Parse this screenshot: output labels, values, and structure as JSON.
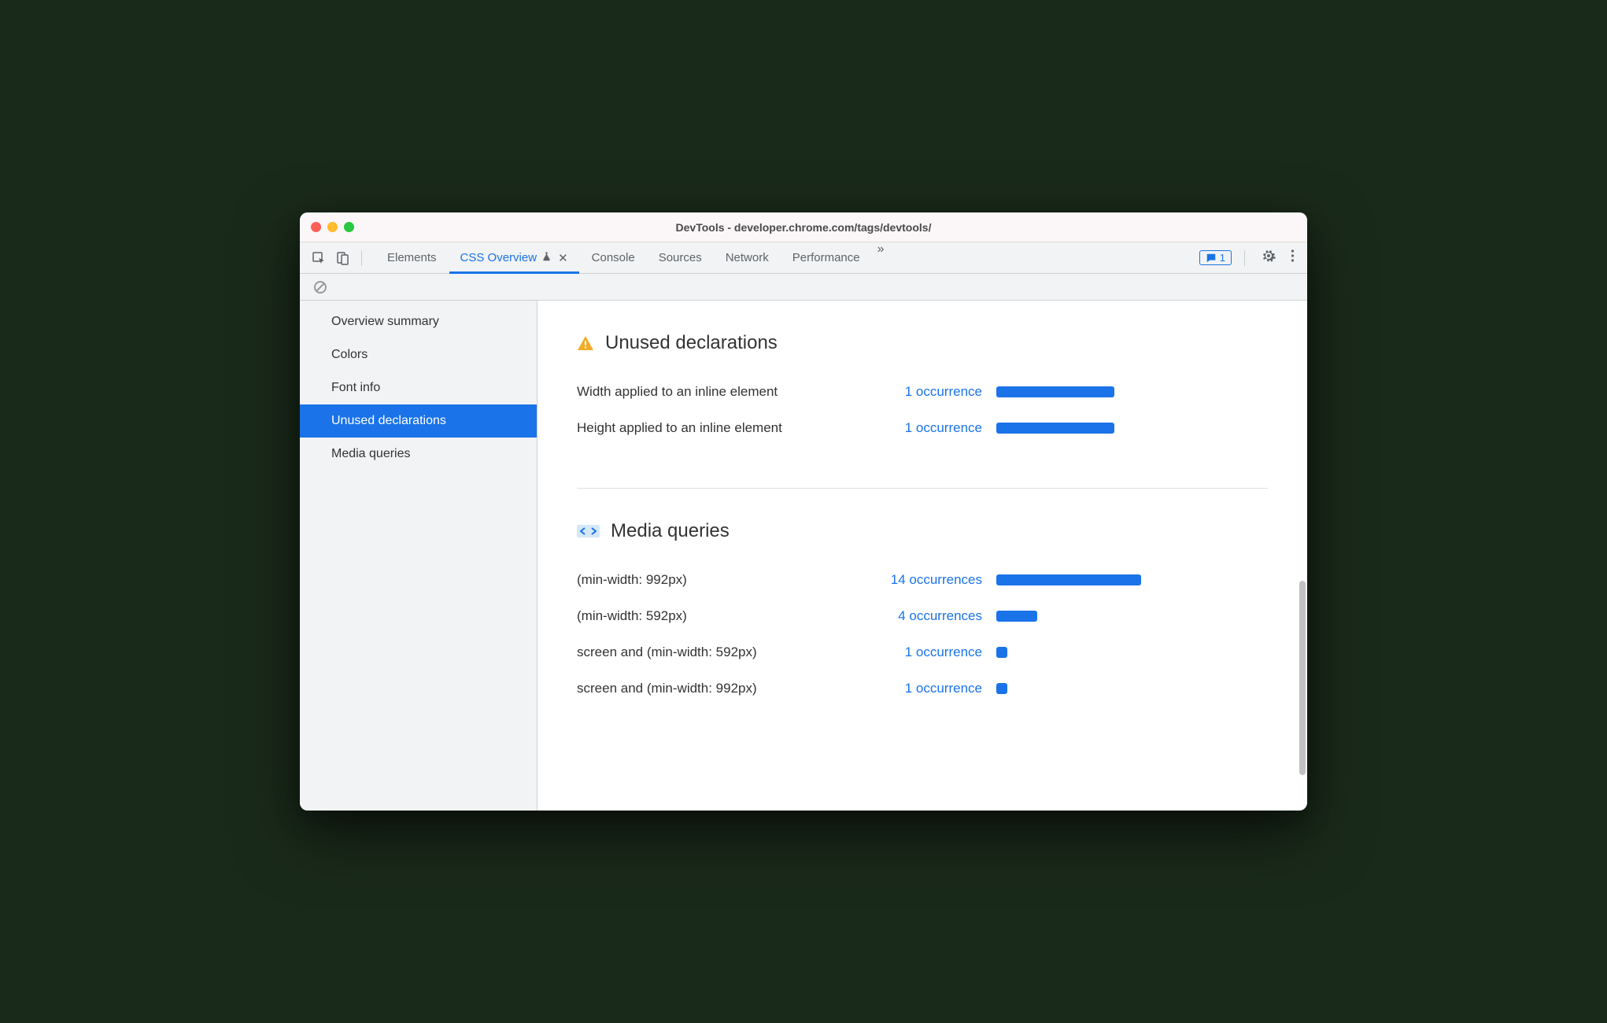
{
  "window": {
    "title": "DevTools - developer.chrome.com/tags/devtools/"
  },
  "toolbar": {
    "tabs": [
      {
        "label": "Elements",
        "active": false
      },
      {
        "label": "CSS Overview",
        "active": true,
        "experimental": true,
        "closable": true
      },
      {
        "label": "Console",
        "active": false
      },
      {
        "label": "Sources",
        "active": false
      },
      {
        "label": "Network",
        "active": false
      },
      {
        "label": "Performance",
        "active": false
      }
    ],
    "messages_count": "1"
  },
  "sidebar": {
    "items": [
      {
        "label": "Overview summary",
        "active": false
      },
      {
        "label": "Colors",
        "active": false
      },
      {
        "label": "Font info",
        "active": false
      },
      {
        "label": "Unused declarations",
        "active": true
      },
      {
        "label": "Media queries",
        "active": false
      }
    ]
  },
  "sections": {
    "unused": {
      "title": "Unused declarations",
      "rows": [
        {
          "label": "Width applied to an inline element",
          "count_text": "1 occurrence",
          "bar_pct": 75
        },
        {
          "label": "Height applied to an inline element",
          "count_text": "1 occurrence",
          "bar_pct": 75
        }
      ]
    },
    "media": {
      "title": "Media queries",
      "rows": [
        {
          "label": "(min-width: 992px)",
          "count_text": "14 occurrences",
          "bar_pct": 92
        },
        {
          "label": "(min-width: 592px)",
          "count_text": "4 occurrences",
          "bar_pct": 26
        },
        {
          "label": "screen and (min-width: 592px)",
          "count_text": "1 occurrence",
          "bar_pct": 7
        },
        {
          "label": "screen and (min-width: 992px)",
          "count_text": "1 occurrence",
          "bar_pct": 7
        }
      ]
    }
  }
}
